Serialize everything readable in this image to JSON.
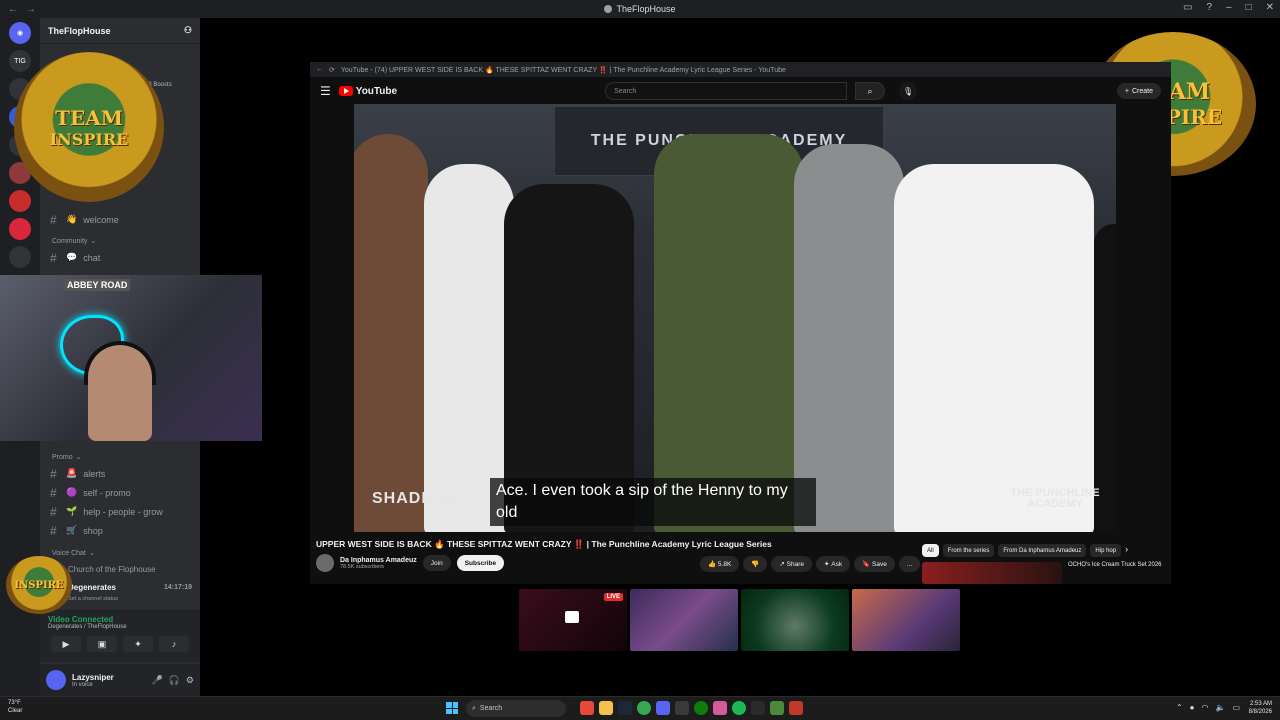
{
  "window": {
    "title": "TheFlopHouse"
  },
  "discord": {
    "server_name": "TheFlopHouse",
    "boosts": "4/33 Boosts",
    "channels_top": [
      {
        "name": "welcome",
        "emoji": "👋"
      }
    ],
    "category_community": "Community",
    "channels_community": [
      {
        "name": "chat",
        "emoji": "💬"
      }
    ],
    "category_promo": "Promo",
    "channels_promo": [
      {
        "name": "alerts",
        "emoji": "🚨"
      },
      {
        "name": "self - promo",
        "emoji": "🟣"
      },
      {
        "name": "help - people - grow",
        "emoji": "🌱"
      },
      {
        "name": "shop",
        "emoji": "🛒"
      }
    ],
    "category_voice": "Voice Chat",
    "voice_channels": [
      {
        "name": "Church of the Flophouse",
        "time": ""
      },
      {
        "name": "Degenerates",
        "time": "14:17:19",
        "sub": "Set a channel status"
      }
    ],
    "voice_status": "Video Connected",
    "voice_location": "Degenerates / TheFlopHouse",
    "user": {
      "name": "Lazysniper",
      "status": "In voice"
    },
    "webcam_sign": "ABBEY ROAD"
  },
  "logo": {
    "line1": "TEAM",
    "line2": "INSPIRE"
  },
  "browser": {
    "tab_title": "YouTube - (74) UPPER WEST SIDE IS BACK 🔥 THESE SPITTAZ WENT CRAZY ‼️ | The Punchline Academy Lyric League Series - YouTube"
  },
  "youtube": {
    "logo_text": "YouTube",
    "search_placeholder": "Search",
    "create_label": "Create",
    "video_title": "UPPER WEST SIDE IS BACK 🔥 THESE SPITTAZ WENT CRAZY ‼️ | The Punchline Academy Lyric League Series",
    "channel_name": "Da Inphamus Amadeuz",
    "subscribers": "78.5K subscribers",
    "join_label": "Join",
    "subscribe_label": "Subscribe",
    "likes": "5.8K",
    "share_label": "Share",
    "ask_label": "Ask",
    "save_label": "Save",
    "more_label": "...",
    "chips": [
      "All",
      "From the series",
      "From Da Inphamus Amadeuz",
      "Hip hop"
    ],
    "caption": "Ace. I even took a sip of the Henny to my old",
    "watermark_left": "SHADE 45",
    "watermark_right": "THE PUNCHLINE ACADEMY",
    "banner_text": "THE PUNCHLINE ACADEMY",
    "recommended": [
      {
        "title": "OCHO's Ice Cream Truck Set 2026"
      }
    ]
  },
  "streams": {
    "live_label": "LIVE"
  },
  "taskbar": {
    "weather_temp": "73°F",
    "weather_desc": "Clear",
    "search_placeholder": "Search",
    "time": "2:53 AM",
    "date": "8/8/2026"
  },
  "colors": {
    "discord_bg": "#2b2d31",
    "discord_rail": "#1e1f22",
    "youtube_red": "#ff0000",
    "voice_green": "#23a55a"
  }
}
